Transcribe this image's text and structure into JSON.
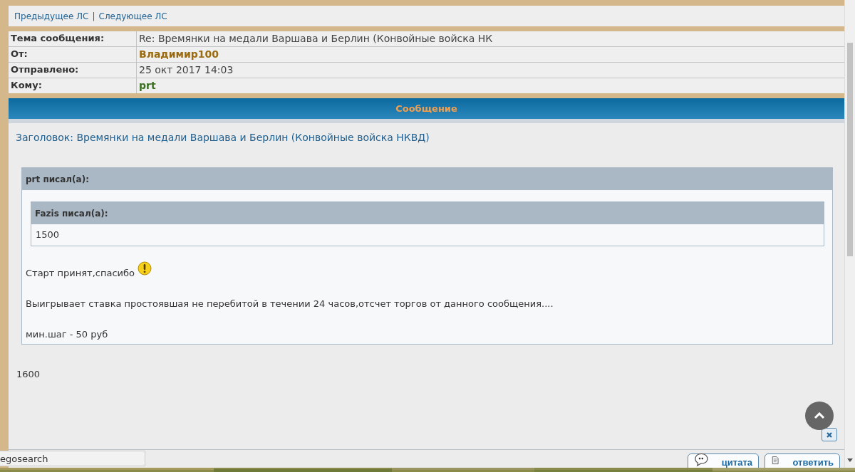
{
  "nav": {
    "links": [
      "Предыдущее ЛС",
      "Следующее ЛС"
    ],
    "separator": "|"
  },
  "header_fields": [
    {
      "label": "Тема сообщения:",
      "value": "Re: Времянки на медали Варшава и Берлин (Конвойные войска НК",
      "kind": "subject"
    },
    {
      "label": "От:",
      "value": "Владимир100",
      "kind": "sender"
    },
    {
      "label": "Отправлено:",
      "value": "25 окт 2017 14:03",
      "kind": "date"
    },
    {
      "label": "Кому:",
      "value": "prt",
      "kind": "recipient"
    }
  ],
  "message": {
    "section_title": "Сообщение",
    "subject": "Заголовок: Времянки на медали Варшава и Берлин (Конвойные войска НКВД)",
    "quote": {
      "author_line": "prt писал(а):",
      "nested_quote": {
        "author_line": "Fazis писал(а):",
        "text": "1500"
      },
      "paragraphs": [
        {
          "text": "Старт принят,спасибо",
          "emoticon": true
        },
        {
          "text": "Выигрывает ставка простоявшая не перебитой в течении 24 часов,отсчет торгов от данного сообщения....",
          "emoticon": false
        },
        {
          "text": "мин.шаг - 50 руб",
          "emoticon": false
        }
      ]
    },
    "reply": "1600"
  },
  "buttons": [
    {
      "label": "цитата",
      "kind": "quote"
    },
    {
      "label": "ответить",
      "kind": "reply"
    }
  ],
  "status_tooltip": "egosearch"
}
